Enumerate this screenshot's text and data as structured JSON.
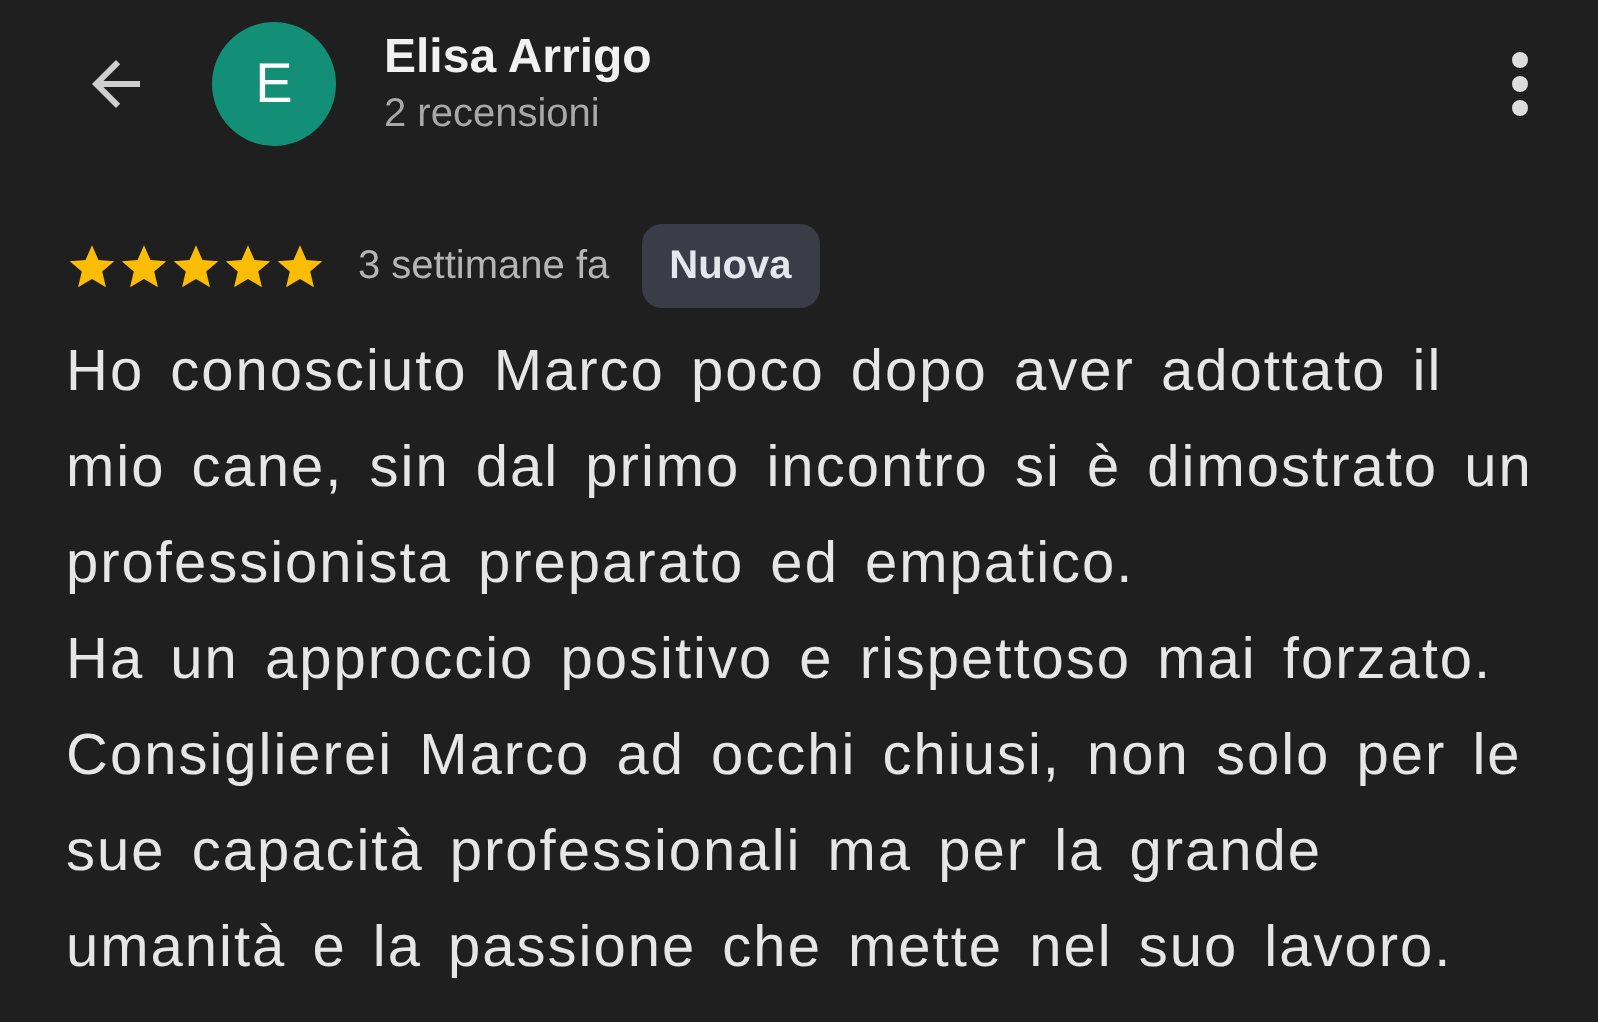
{
  "reviewer": {
    "name": "Elisa Arrigo",
    "initial": "E",
    "reviews": "2 recensioni"
  },
  "review": {
    "stars": 5,
    "time": "3 settimane fa",
    "badge": "Nuova",
    "paragraphs": [
      "Ho conosciuto Marco poco dopo aver adottato il mio cane, sin dal primo incontro si è dimostrato un professionista preparato ed empatico.",
      "Ha un approccio positivo e rispettoso mai forzato.",
      "Consiglierei Marco ad occhi chiusi, non solo per le sue capacità professionali ma per la grande umanità e la passione che mette nel suo lavoro."
    ]
  }
}
